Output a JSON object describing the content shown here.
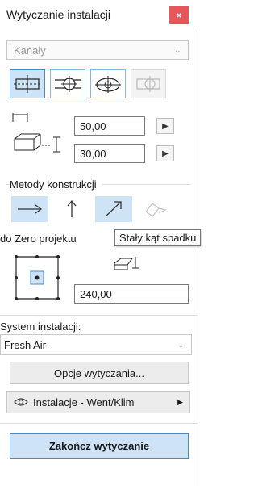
{
  "window": {
    "title": "Wytyczanie instalacji",
    "close_label": "×"
  },
  "system_category": {
    "value": "Kanały"
  },
  "geometry": {
    "width_value": "50,00",
    "height_value": "30,00"
  },
  "methods": {
    "section_label": "Metody konstrukcji",
    "tooltip": "Stały kąt spadku"
  },
  "reference": {
    "label": "do Zero projektu",
    "offset_value": "240,00"
  },
  "system": {
    "label": "System instalacji:",
    "value": "Fresh Air"
  },
  "buttons": {
    "options_label": "Opcje wytyczania...",
    "layer_label": "Instalacje - Went/Klim",
    "finish_label": "Zakończ wytyczanie"
  },
  "colors": {
    "accent": "#4a88c7",
    "accent_fill": "#cfe3f6",
    "close": "#e8565b"
  }
}
